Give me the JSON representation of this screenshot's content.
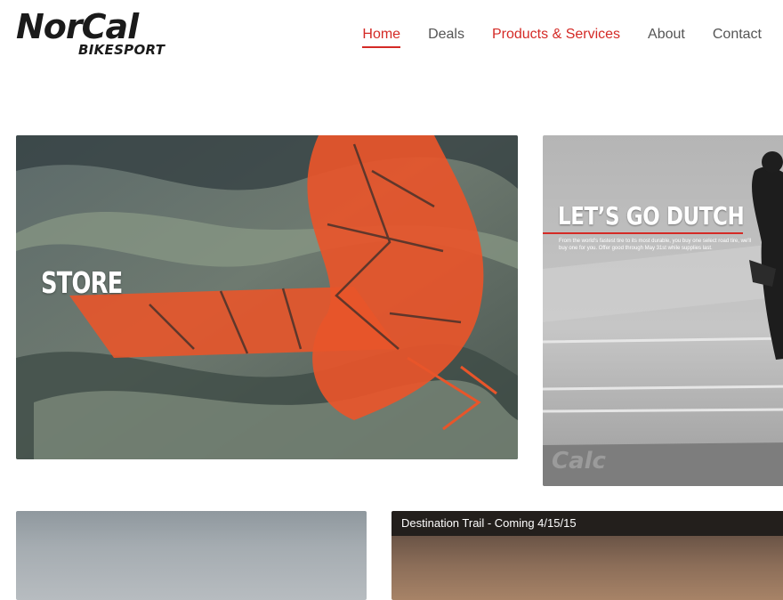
{
  "header": {
    "logo_line1": "NorCal",
    "logo_line2": "BIKESPORT",
    "nav": [
      {
        "label": "Home"
      },
      {
        "label": "Deals"
      },
      {
        "label": "Products & Services"
      },
      {
        "label": "About"
      },
      {
        "label": "Contact"
      }
    ]
  },
  "tiles": {
    "store": {
      "label": "STORE"
    },
    "dutch": {
      "title": "LET’S GO DUTCH",
      "copy": "From the world's fastest tire to its most durable, you buy one select road tire, we'll buy one for you. Offer good through May 31st while supplies last."
    },
    "trail": {
      "caption": "Destination Trail - Coming 4/15/15"
    }
  },
  "colors": {
    "accent": "#d42a26",
    "nav_text": "#555555",
    "caption_bar": "#231f1c"
  }
}
